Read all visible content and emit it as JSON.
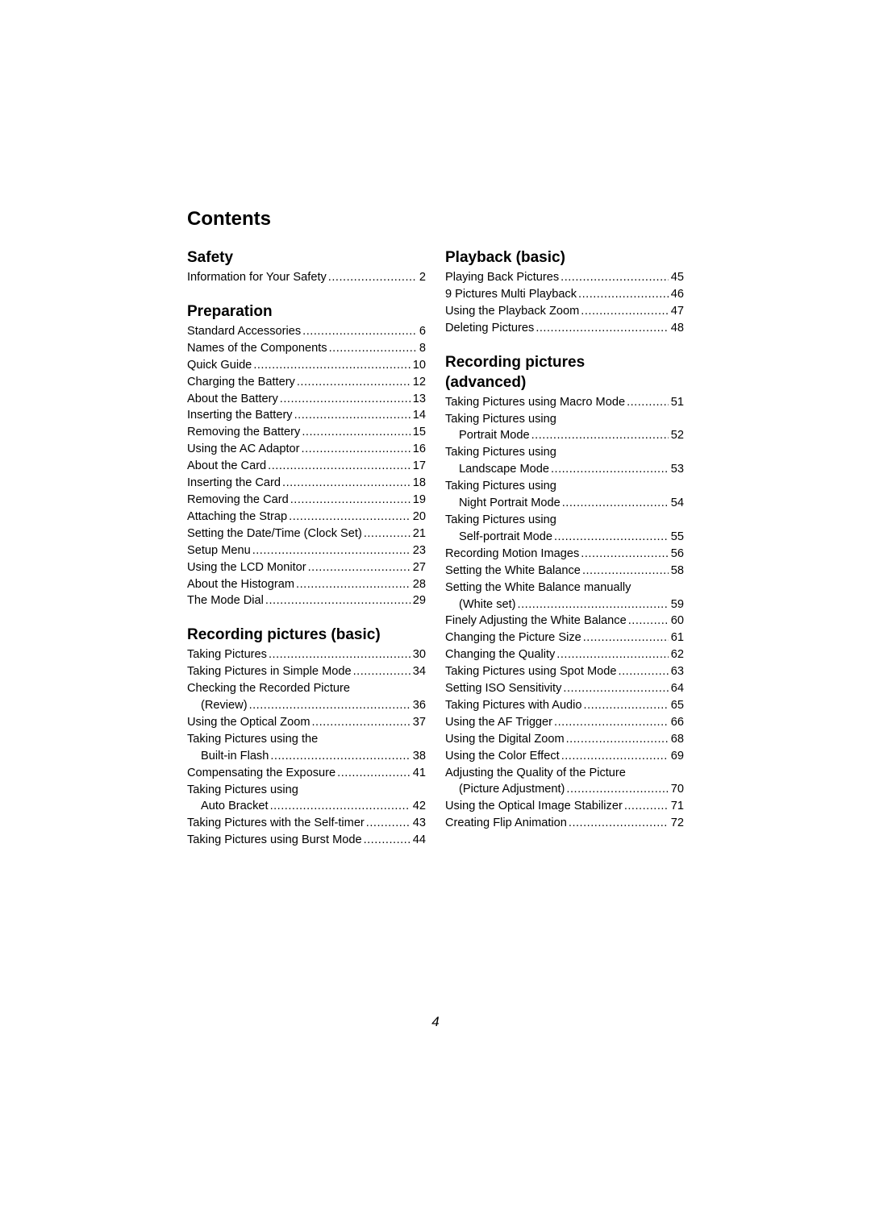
{
  "title": "Contents",
  "page_number": "4",
  "left_column": [
    {
      "heading": "Safety",
      "entries": [
        {
          "title": "Information for Your Safety",
          "page": "2"
        }
      ]
    },
    {
      "heading": "Preparation",
      "entries": [
        {
          "title": "Standard Accessories",
          "page": "6"
        },
        {
          "title": "Names of the Components",
          "page": "8"
        },
        {
          "title": "Quick Guide",
          "page": "10"
        },
        {
          "title": "Charging the Battery",
          "page": "12"
        },
        {
          "title": "About the Battery",
          "page": "13"
        },
        {
          "title": "Inserting the Battery",
          "page": "14"
        },
        {
          "title": "Removing the Battery",
          "page": "15"
        },
        {
          "title": "Using the AC Adaptor",
          "page": "16"
        },
        {
          "title": "About the Card",
          "page": "17"
        },
        {
          "title": "Inserting the Card",
          "page": "18"
        },
        {
          "title": "Removing the Card",
          "page": "19"
        },
        {
          "title": "Attaching the Strap",
          "page": "20"
        },
        {
          "title": "Setting the Date/Time (Clock Set)",
          "page": "21"
        },
        {
          "title": "Setup Menu",
          "page": "23"
        },
        {
          "title": "Using the LCD Monitor",
          "page": "27"
        },
        {
          "title": "About the Histogram",
          "page": "28"
        },
        {
          "title": "The Mode Dial",
          "page": "29"
        }
      ]
    },
    {
      "heading": "Recording pictures (basic)",
      "entries": [
        {
          "title": "Taking Pictures",
          "page": "30"
        },
        {
          "title": "Taking Pictures in Simple Mode",
          "page": "34"
        },
        {
          "title": "Checking the Recorded Picture",
          "continuation": "(Review)",
          "page": "36"
        },
        {
          "title": "Using the Optical Zoom",
          "page": "37"
        },
        {
          "title": "Taking Pictures using the",
          "continuation": "Built-in Flash",
          "page": "38"
        },
        {
          "title": "Compensating the Exposure",
          "page": "41"
        },
        {
          "title": "Taking Pictures using",
          "continuation": "Auto Bracket",
          "page": "42"
        },
        {
          "title": "Taking Pictures with the Self-timer",
          "page": "43"
        },
        {
          "title": "Taking Pictures using Burst Mode",
          "page": "44"
        }
      ]
    }
  ],
  "right_column": [
    {
      "heading": "Playback (basic)",
      "entries": [
        {
          "title": "Playing Back Pictures",
          "page": "45"
        },
        {
          "title": "9 Pictures Multi Playback",
          "page": "46"
        },
        {
          "title": "Using the Playback Zoom",
          "page": "47"
        },
        {
          "title": "Deleting Pictures",
          "page": "48"
        }
      ]
    },
    {
      "heading": "Recording pictures (advanced)",
      "entries": [
        {
          "title": "Taking Pictures using Macro Mode",
          "page": "51"
        },
        {
          "title": "Taking Pictures using",
          "continuation": "Portrait Mode",
          "page": "52"
        },
        {
          "title": "Taking Pictures using",
          "continuation": "Landscape Mode",
          "page": "53"
        },
        {
          "title": "Taking Pictures using",
          "continuation": "Night Portrait Mode",
          "page": "54"
        },
        {
          "title": "Taking Pictures using",
          "continuation": "Self-portrait Mode",
          "page": "55"
        },
        {
          "title": "Recording Motion Images",
          "page": "56"
        },
        {
          "title": "Setting the White Balance",
          "page": "58"
        },
        {
          "title": "Setting the White Balance manually",
          "continuation": "(White set)",
          "page": "59"
        },
        {
          "title": "Finely Adjusting the White Balance",
          "page": "60"
        },
        {
          "title": "Changing the Picture Size",
          "page": "61"
        },
        {
          "title": "Changing the Quality",
          "page": "62"
        },
        {
          "title": "Taking Pictures using Spot Mode",
          "page": "63"
        },
        {
          "title": "Setting ISO Sensitivity",
          "page": "64"
        },
        {
          "title": "Taking Pictures with Audio",
          "page": "65"
        },
        {
          "title": "Using the AF Trigger",
          "page": "66"
        },
        {
          "title": "Using the Digital Zoom",
          "page": "68"
        },
        {
          "title": "Using the Color Effect",
          "page": "69"
        },
        {
          "title": "Adjusting the Quality of the Picture",
          "continuation": "(Picture Adjustment)",
          "page": "70"
        },
        {
          "title": "Using the Optical Image Stabilizer",
          "page": "71"
        },
        {
          "title": "Creating Flip Animation",
          "page": "72"
        }
      ]
    }
  ]
}
